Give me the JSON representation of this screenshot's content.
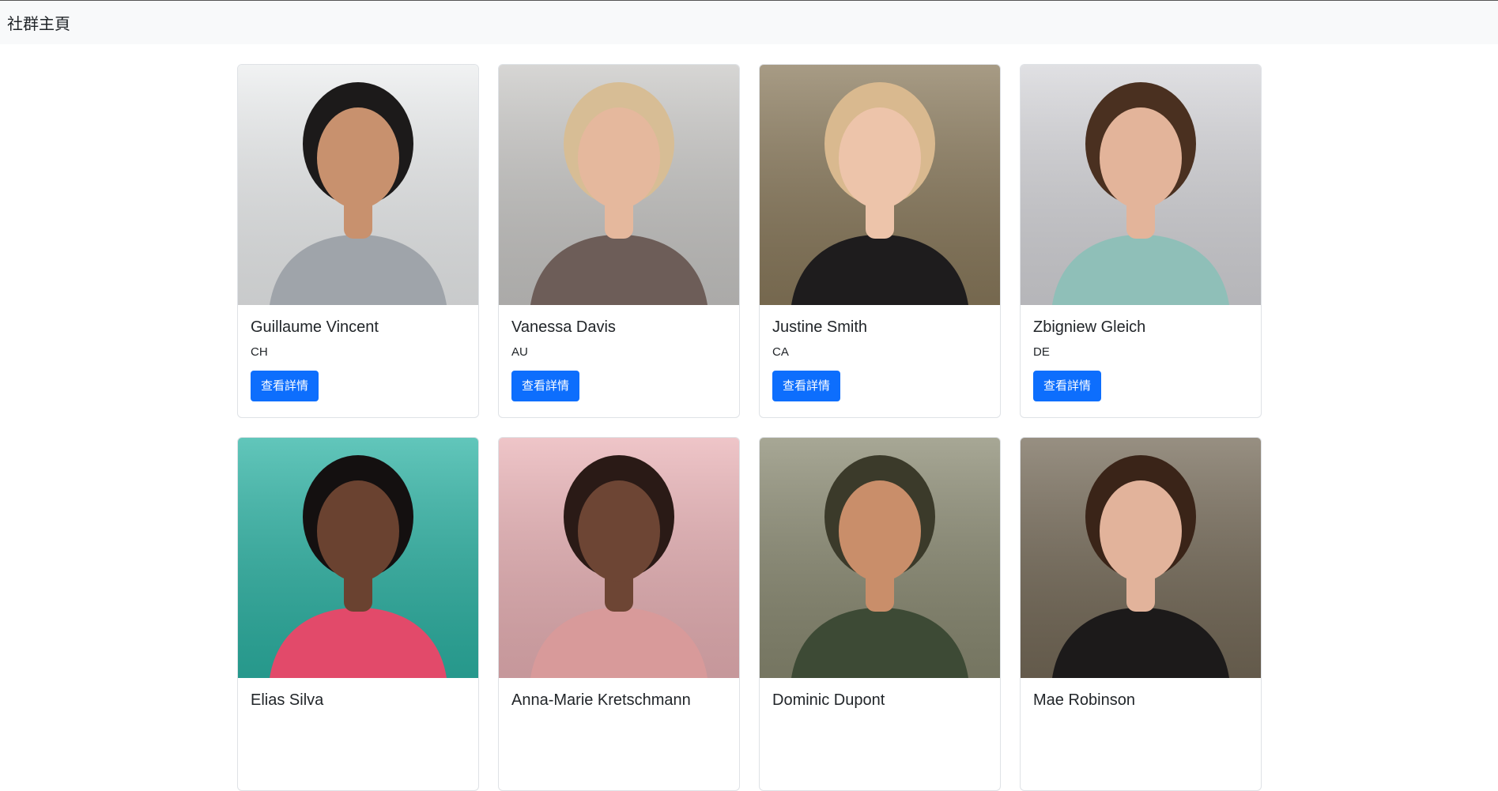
{
  "navbar": {
    "brand": "社群主頁"
  },
  "profiles": [
    {
      "name": "Guillaume Vincent",
      "country": "CH",
      "button": "查看詳情",
      "bg": "#eceeef",
      "skin": "#c8916e",
      "hair": "#1c1a1a",
      "shirt": "#9fa4aa"
    },
    {
      "name": "Vanessa Davis",
      "country": "AU",
      "button": "查看詳情",
      "bg": "#c9c8c6",
      "skin": "#e5b89d",
      "hair": "#d7bd95",
      "shirt": "#6d5d58"
    },
    {
      "name": "Justine Smith",
      "country": "CA",
      "button": "查看詳情",
      "bg": "#8a7a5c",
      "skin": "#edc4aa",
      "hair": "#d9b98f",
      "shirt": "#1e1c1d"
    },
    {
      "name": "Zbigniew Gleich",
      "country": "DE",
      "button": "查看詳情",
      "bg": "#d6d6da",
      "skin": "#e3b49a",
      "hair": "#4a3020",
      "shirt": "#8fbfb8"
    },
    {
      "name": "Elias Silva",
      "country": "",
      "button": "",
      "bg": "#2db3a4",
      "skin": "#6a4230",
      "hair": "#141010",
      "shirt": "#e24a6a"
    },
    {
      "name": "Anna-Marie Kretschmann",
      "country": "",
      "button": "",
      "bg": "#e9b2b6",
      "skin": "#6d4534",
      "hair": "#2a1a16",
      "shirt": "#d89a9a"
    },
    {
      "name": "Dominic Dupont",
      "country": "",
      "button": "",
      "bg": "#8a8a72",
      "skin": "#c98e6a",
      "hair": "#3b3a2a",
      "shirt": "#3d4a35"
    },
    {
      "name": "Mae Robinson",
      "country": "",
      "button": "",
      "bg": "#756a58",
      "skin": "#e2b39b",
      "hair": "#3a2418",
      "shirt": "#1c1a1a"
    }
  ]
}
